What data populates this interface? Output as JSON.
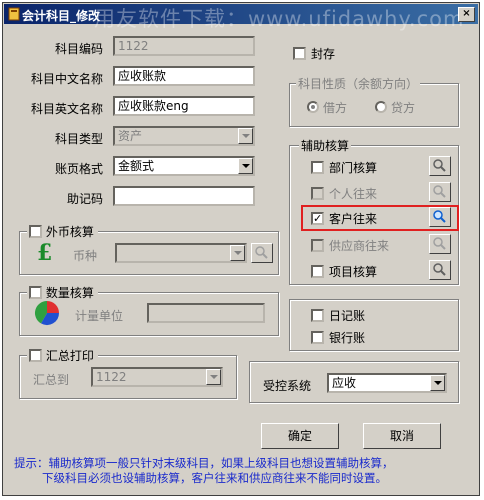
{
  "window": {
    "title": "会计科目_修改",
    "watermark": "用友软件下载：www.ufidawhy.com",
    "close_label": "×"
  },
  "fields": {
    "code_label": "科目编码",
    "code_value": "1122",
    "cn_name_label": "科目中文名称",
    "cn_name_value": "应收账款",
    "en_name_label": "科目英文名称",
    "en_name_value": "应收账款eng",
    "type_label": "科目类型",
    "type_value": "资产",
    "format_label": "账页格式",
    "format_value": "金额式",
    "mnemonic_label": "助记码",
    "mnemonic_value": ""
  },
  "seal": {
    "label": "封存",
    "checked": false
  },
  "nature": {
    "title": "科目性质（余额方向）",
    "debit": "借方",
    "credit": "贷方",
    "selected": "借方"
  },
  "foreign": {
    "title": "外币核算",
    "currency_label": "币种",
    "currency_value": "",
    "icon": "pound-currency-icon"
  },
  "quantity": {
    "title": "数量核算",
    "unit_label": "计量单位",
    "unit_value": "",
    "icon": "pie-chart-icon"
  },
  "summary": {
    "title": "汇总打印",
    "to_label": "汇总到",
    "to_value": "1122"
  },
  "aux": {
    "title": "辅助核算",
    "items": [
      {
        "label": "部门核算",
        "checked": false,
        "enabled": true
      },
      {
        "label": "个人往来",
        "checked": false,
        "enabled": false
      },
      {
        "label": "客户往来",
        "checked": true,
        "enabled": true
      },
      {
        "label": "供应商往来",
        "checked": false,
        "enabled": false
      },
      {
        "label": "项目核算",
        "checked": false,
        "enabled": true
      }
    ]
  },
  "books": {
    "journal": "日记账",
    "bank": "银行账"
  },
  "controlled": {
    "label": "受控系统",
    "value": "应收"
  },
  "buttons": {
    "ok": "确定",
    "cancel": "取消"
  },
  "tip": {
    "line1": "提示：辅助核算项一般只针对末级科目，如果上级科目也想设置辅助核算，",
    "line2": "下级科目必须也设辅助核算，客户往来和供应商往来不能同时设置。"
  },
  "colors": {
    "titlebar": "#0a246a",
    "dialog": "#d4d0c8",
    "highlight": "#e02020",
    "tip_text": "#1a2acc"
  }
}
